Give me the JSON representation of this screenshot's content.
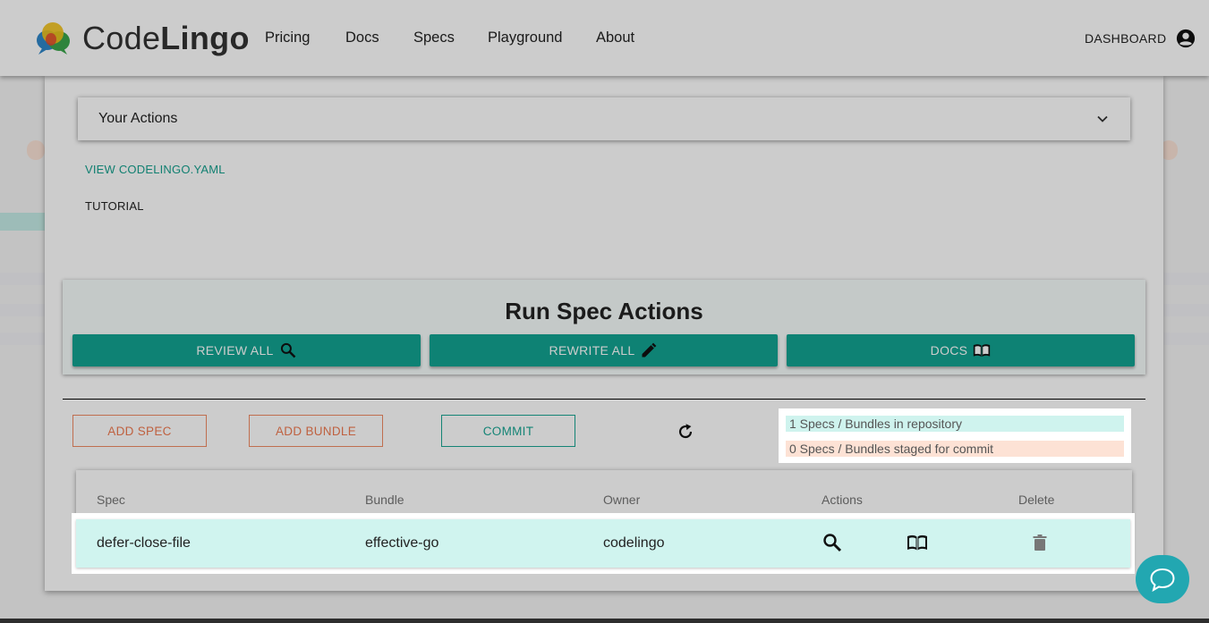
{
  "header": {
    "brand_light": "Code",
    "brand_bold": "Lingo",
    "nav": [
      "Pricing",
      "Docs",
      "Specs",
      "Playground",
      "About"
    ],
    "dashboard_label": "DASHBOARD"
  },
  "actions_panel": {
    "title": "Your Actions",
    "view_yaml_label": "VIEW CODELINGO.YAML",
    "tutorial_label": "TUTORIAL"
  },
  "run_spec": {
    "title": "Run Spec Actions",
    "review_all_label": "REVIEW ALL",
    "rewrite_all_label": "REWRITE ALL",
    "docs_label": "DOCS"
  },
  "toolbar": {
    "add_spec_label": "ADD SPEC",
    "add_bundle_label": "ADD BUNDLE",
    "commit_label": "COMMIT"
  },
  "counts": {
    "in_repo": "1 Specs / Bundles in repository",
    "staged": "0 Specs / Bundles staged for commit"
  },
  "table": {
    "headers": [
      "Spec",
      "Bundle",
      "Owner",
      "Actions",
      "Delete"
    ],
    "rows": [
      {
        "spec": "defer-close-file",
        "bundle": "effective-go",
        "owner": "codelingo"
      }
    ]
  },
  "colors": {
    "accent": "#12a391",
    "orange": "#ef7a50",
    "row_highlight": "#d0f4ef",
    "chat": "#22a7b1"
  },
  "icons": {
    "review": "search-icon",
    "rewrite": "pencil-icon",
    "docs": "book-icon",
    "refresh": "refresh-icon",
    "delete": "trash-icon",
    "chat": "chat-bubble-icon",
    "account": "account-circle-icon",
    "expand": "chevron-down-icon"
  }
}
